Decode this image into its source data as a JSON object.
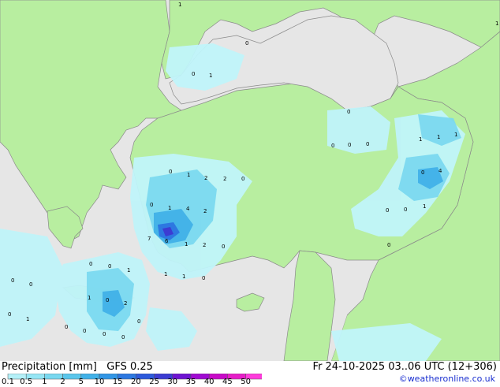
{
  "title": {
    "variable": "Precipitation [mm]",
    "model": "GFS 0.25",
    "valid": "Fr 24-10-2025 03..06 UTC (12+306)"
  },
  "copyright": "©weatheronline.co.uk",
  "legend": {
    "labels": [
      "0.1",
      "0.5",
      "1",
      "2",
      "5",
      "10",
      "15",
      "20",
      "25",
      "30",
      "35",
      "40",
      "45",
      "50"
    ],
    "colors": [
      "#b4f0f8",
      "#96e6f5",
      "#78d8f0",
      "#5ac6ec",
      "#41b1e8",
      "#3296e6",
      "#2d78e1",
      "#2d5adc",
      "#3c3cd2",
      "#6e14d2",
      "#a00ad2",
      "#c80ac8",
      "#e61ec8",
      "#ff3cdc"
    ]
  },
  "colors": {
    "land": "#b8eea0",
    "sea": "#e6e6e6",
    "light_rain": "#c0f4fa"
  },
  "map_labels": {
    "nw1": "1",
    "ne1": "1",
    "blacksea_0": "0",
    "blacksea_01": "0",
    "blacksea_1": "1",
    "e_0a": "0",
    "e_0b": "0",
    "e_0c": "0",
    "e_0d": "0",
    "far_e1a": "1",
    "far_e1b": "1",
    "far_e1c": "1",
    "far_e0": "0",
    "far_e4": "4",
    "se_0a": "0",
    "se_0b": "0",
    "se_1": "1",
    "se_0c": "0",
    "w_0a": "0",
    "w_1a": "1",
    "w_2a": "2",
    "w_2b": "2",
    "w_0b": "0",
    "w_0c": "0",
    "w_1b": "1",
    "w_4": "4",
    "w_2c": "2",
    "core_7": "7",
    "core_6": "6",
    "core_1": "1",
    "core_2": "2",
    "core_0": "0",
    "s_0a": "0",
    "s_1a": "1",
    "s_0b": "0",
    "s_1b": "1",
    "s_1c": "1",
    "s_0c": "0",
    "crete_0a": "0",
    "crete_0b": "0",
    "crete_1": "1",
    "crete_0c": "0",
    "crete_2": "2",
    "crete_0d": "0",
    "sw_0a": "0",
    "sw_1": "1",
    "sw_0b": "0",
    "sw_0c": "0",
    "sw_0d": "0",
    "sw_0e": "0"
  }
}
